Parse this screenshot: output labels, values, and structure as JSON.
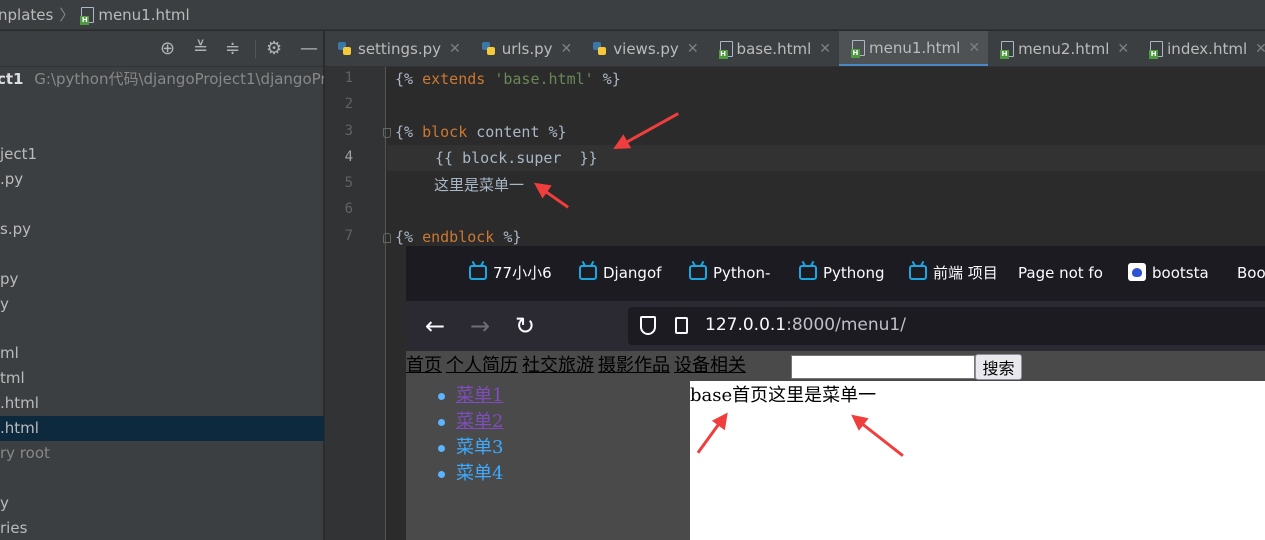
{
  "breadcrumb": {
    "folder": "nplates",
    "file": "menu1.html"
  },
  "project": {
    "tools": [
      "target-icon",
      "expand-icon",
      "collapse-icon",
      "gear-icon",
      "minimize-icon"
    ],
    "root_name": "ct1",
    "root_path": "G:\\python代码\\djangoProject1\\djangoPro",
    "rows": [
      "ject1",
      ".py",
      "s.py",
      "py",
      "y",
      "ml",
      "tml",
      ".html",
      ".html",
      "ry root",
      "y",
      "ries"
    ]
  },
  "tabs": [
    {
      "label": "settings.py",
      "type": "py"
    },
    {
      "label": "urls.py",
      "type": "py"
    },
    {
      "label": "views.py",
      "type": "py"
    },
    {
      "label": "base.html",
      "type": "html"
    },
    {
      "label": "menu1.html",
      "type": "html",
      "active": true
    },
    {
      "label": "menu2.html",
      "type": "html"
    },
    {
      "label": "index.html",
      "type": "html"
    }
  ],
  "editor": {
    "line_numbers": [
      "1",
      "2",
      "3",
      "4",
      "5",
      "6",
      "7"
    ],
    "line1": {
      "open": "{% ",
      "kw": "extends",
      "str": "'base.html'",
      "close": " %}"
    },
    "line3": {
      "open": "{% ",
      "kw": "block",
      "name": " content",
      "close": " %}"
    },
    "line4": "{{ block.super  }}",
    "line5": "这里是菜单一",
    "line7": {
      "open": "{% ",
      "kw": "endblock",
      "close": " %}"
    }
  },
  "browser": {
    "bookmarks": [
      {
        "label": "77小小6",
        "icon": "bilibili-icon"
      },
      {
        "label": "Djangof",
        "icon": "bilibili-icon"
      },
      {
        "label": "Python-",
        "icon": "bilibili-icon"
      },
      {
        "label": "Pythong",
        "icon": "bilibili-icon"
      },
      {
        "label": "前端 项目",
        "icon": "bilibili-icon"
      },
      {
        "label": "Page not fo",
        "icon": ""
      },
      {
        "label": "bootsta",
        "icon": "baidu-icon"
      },
      {
        "label": "Boo",
        "icon": ""
      }
    ],
    "url_host": "127.0.0.1",
    "url_rest": ":8000/menu1/",
    "page": {
      "nav_links": [
        "首页",
        "个人简历",
        "社交旅游",
        "摄影作品",
        "设备相关"
      ],
      "search_value": "",
      "search_button": "搜索",
      "side_menu": [
        {
          "label": "菜单1",
          "visited": true
        },
        {
          "label": "菜单2",
          "visited": true
        },
        {
          "label": "菜单3",
          "visited": false
        },
        {
          "label": "菜单4",
          "visited": false
        }
      ],
      "content_text": "base首页这里是菜单一"
    }
  },
  "colors": {
    "annotation_arrow": "#f03d3d",
    "tab_underline": "#4a88c7",
    "link_visited": "#7f4dbd",
    "link": "#3daaff"
  }
}
